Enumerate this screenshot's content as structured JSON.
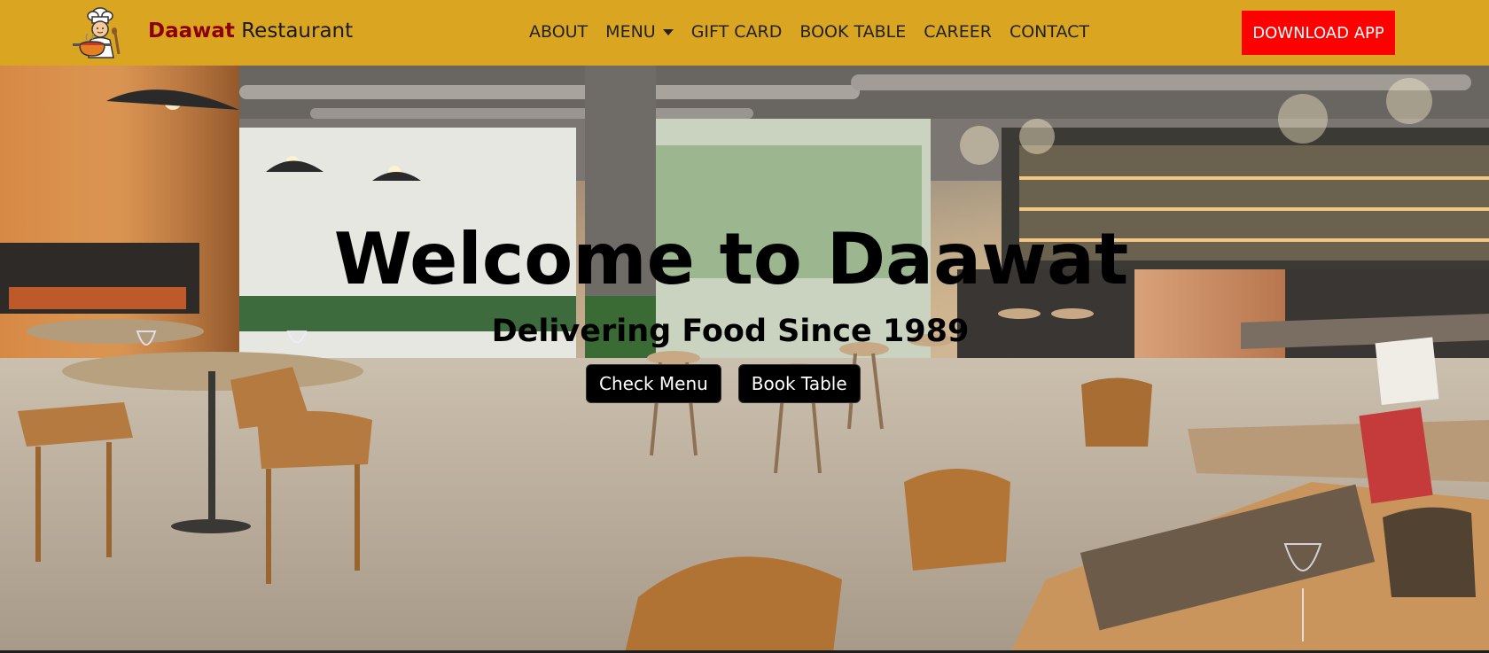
{
  "navbar": {
    "brand_accent": "Daawat",
    "brand_rest": " Restaurant",
    "links": [
      "ABOUT",
      "MENU",
      "GIFT CARD",
      "BOOK TABLE",
      "CAREER",
      "CONTACT"
    ],
    "download_label": "DOWNLOAD APP",
    "background_color": "#daa520",
    "download_color": "#ff0000"
  },
  "hero": {
    "title": "Welcome to Daawat",
    "subtitle": "Delivering Food Since 1989",
    "buttons": [
      "Check Menu",
      "Book Table"
    ],
    "background_image": "restaurant-interior-photo"
  },
  "icons": {
    "logo": "chef-logo-icon",
    "dropdown": "chevron-down-icon"
  }
}
